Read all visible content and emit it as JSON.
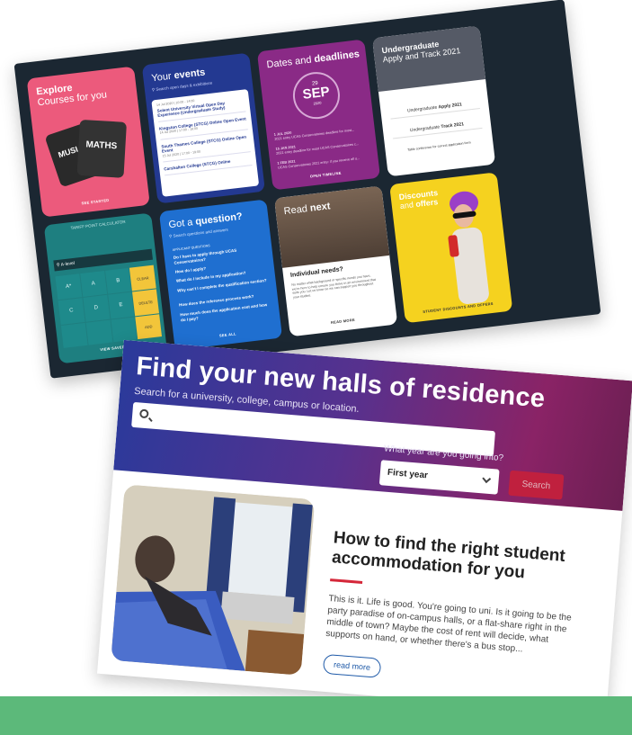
{
  "dashboard": {
    "explore": {
      "title_line1": "Explore",
      "title_line2": "Courses for you",
      "card1": "MUSI",
      "card2": "MATHS",
      "link": "SEE STARTED"
    },
    "events": {
      "title_pre": "Your ",
      "title_bold": "events",
      "search_placeholder": "Search open days & exhibitions",
      "items": [
        {
          "title": "Solent University Virtual Open Day Experience (Undergraduate Study)",
          "meta": "14 Jul 2020 | 10:00 - 14:00"
        },
        {
          "title": "Kingston College (STCG) Online Open Event",
          "meta": "14 Jul 2020 | 17:00 - 19:00"
        },
        {
          "title": "South Thames College (STCG) Online Open Event",
          "meta": "15 Jul 2020 | 17:00 - 19:00"
        },
        {
          "title": "Carshalton College (STCG) Online",
          "meta": ""
        }
      ]
    },
    "dates": {
      "title_pre": "Dates and ",
      "title_bold": "deadlines",
      "day": "29",
      "month": "SEP",
      "year": "2020",
      "items": [
        {
          "date": "1 JUL 2020",
          "text": "2021 entry UCAS Conservatoires deadline for most..."
        },
        {
          "date": "15 JAN 2021",
          "text": "2021 entry deadline for most UCAS Conservatoires c..."
        },
        {
          "date": "1 FEB 2021",
          "text": "UCAS Conservatoires 2021 entry: if you receive all o..."
        }
      ],
      "link": "OPEN TIMELINE"
    },
    "undergrad": {
      "title_bold": "Undergraduate",
      "title_rest": "Apply and Track 2021",
      "line1_pre": "Undergraduate ",
      "line1_bold": "Apply 2021",
      "line2_pre": "Undergraduate ",
      "line2_bold": "Track 2021",
      "line3": "Table conference for correct application form"
    },
    "tariff": {
      "title": "TARIFF POINT CALCULATOR",
      "input": "A-level",
      "grades": [
        "A*",
        "A",
        "B",
        "C",
        "D",
        "E"
      ],
      "actions": [
        "CLEAR",
        "DELETE",
        "ADD"
      ],
      "link": "VIEW SAVED"
    },
    "question": {
      "title_pre": "Got a ",
      "title_bold": "question?",
      "search_placeholder": "Search questions and answers",
      "section": "APPLICANT QUESTIONS",
      "items": [
        "Do I have to apply through UCAS Conservatoires?",
        "How do I apply?",
        "What do I include in my application?",
        "Why can't I complete the qualification section?",
        "How does the reference process work?",
        "How much does the application cost and how do I pay?"
      ],
      "link": "SEE ALL"
    },
    "read": {
      "title_pre": "Read ",
      "title_bold": "next",
      "heading": "Individual needs?",
      "text": "No matter what background or specific needs you have, we're here to help ensure you thrive in an environment that suits you. Let us know so we can support you throughout your studies.",
      "link": "READ MORE"
    },
    "discounts": {
      "title_bold": "Discounts",
      "title_pre": "and ",
      "title_bold2": "offers",
      "link": "STUDENT DISCOUNTS AND OFFERS"
    }
  },
  "halls": {
    "title": "Find your new halls of residence",
    "search_label": "Search for a university, college, campus or location.",
    "search_placeholder": "",
    "year_question": "What year are you going into?",
    "year_selected": "First year",
    "search_button": "Search",
    "article": {
      "title": "How to find the right student accommodation for you",
      "text": "This is it. Life is good. You're going to uni. Is it going to be the party paradise of on-campus halls, or a flat-share right in the middle of town? Maybe the cost of rent will decide, what supports on hand, or whether there's a bus stop...",
      "button": "read more"
    }
  },
  "colors": {
    "explore": "#ec5a7c",
    "events": "#233991",
    "dates": "#8a2a86",
    "tariff": "#1e7f80",
    "question": "#1f6fd0",
    "discounts": "#f5d21f",
    "footer_strip": "#5cb97a",
    "accent_red": "#d5283a"
  }
}
